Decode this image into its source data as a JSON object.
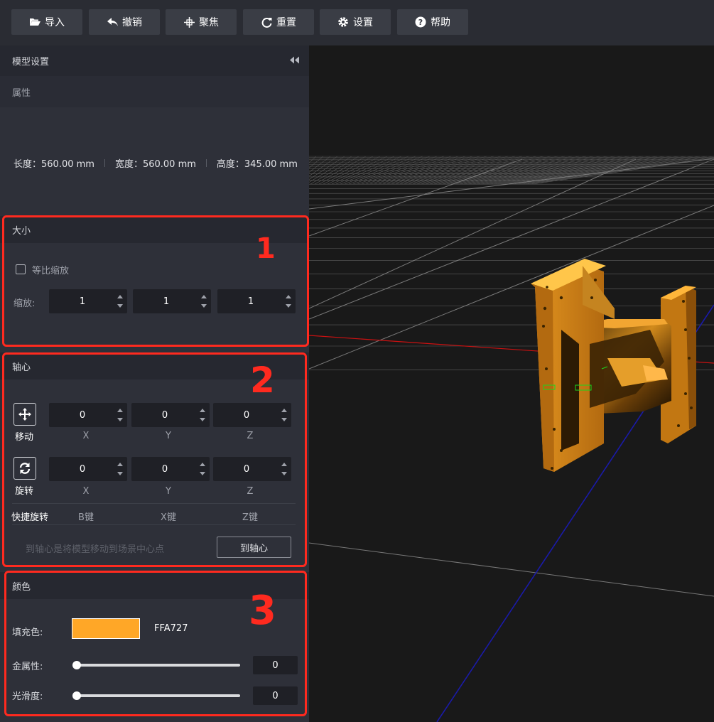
{
  "toolbar": {
    "buttons": [
      {
        "label": "导入",
        "icon": "folder-open-icon"
      },
      {
        "label": "撤销",
        "icon": "undo-icon"
      },
      {
        "label": "聚焦",
        "icon": "crosshair-icon"
      },
      {
        "label": "重置",
        "icon": "refresh-icon"
      },
      {
        "label": "设置",
        "icon": "gear-icon"
      },
      {
        "label": "帮助",
        "icon": "help-icon"
      }
    ]
  },
  "panel": {
    "title": "模型设置",
    "collapse_icon": "double-chevron-left-icon",
    "properties": {
      "heading": "属性",
      "length": "长度：560.00 mm",
      "width": "宽度：560.00 mm",
      "height": "高度：345.00 mm"
    },
    "size": {
      "heading": "大小",
      "proportional_label": "等比缩放",
      "proportional_checked": false,
      "scale_label": "缩放:",
      "scale_values": [
        "1",
        "1",
        "1"
      ]
    },
    "pivot": {
      "heading": "轴心",
      "move_label": "移动",
      "move_icon": "move-arrows-icon",
      "move_values": [
        "0",
        "0",
        "0"
      ],
      "rotate_label": "旋转",
      "rotate_icon": "rotate-icon",
      "rotate_values": [
        "0",
        "0",
        "0"
      ],
      "axes": [
        "X",
        "Y",
        "Z"
      ],
      "quick_rotate_label": "快捷旋转",
      "quick_rotate_keys": [
        "B键",
        "X键",
        "Z键"
      ],
      "hint": "到轴心是将模型移动到场景中心点",
      "to_pivot_button": "到轴心"
    },
    "color": {
      "heading": "颜色",
      "fill_label": "填充色:",
      "fill_hex": "FFA727",
      "fill_color": "#FFA727",
      "metalness_label": "金属性:",
      "metalness_value": "0",
      "smoothness_label": "光滑度:",
      "smoothness_value": "0"
    }
  },
  "annotations": [
    "1",
    "2",
    "3"
  ],
  "colors": {
    "annotation_red": "#ff2a1f",
    "model_orange": "#FFA727",
    "x_axis_red": "#cc1111",
    "z_axis_blue": "#1a1aa8"
  }
}
